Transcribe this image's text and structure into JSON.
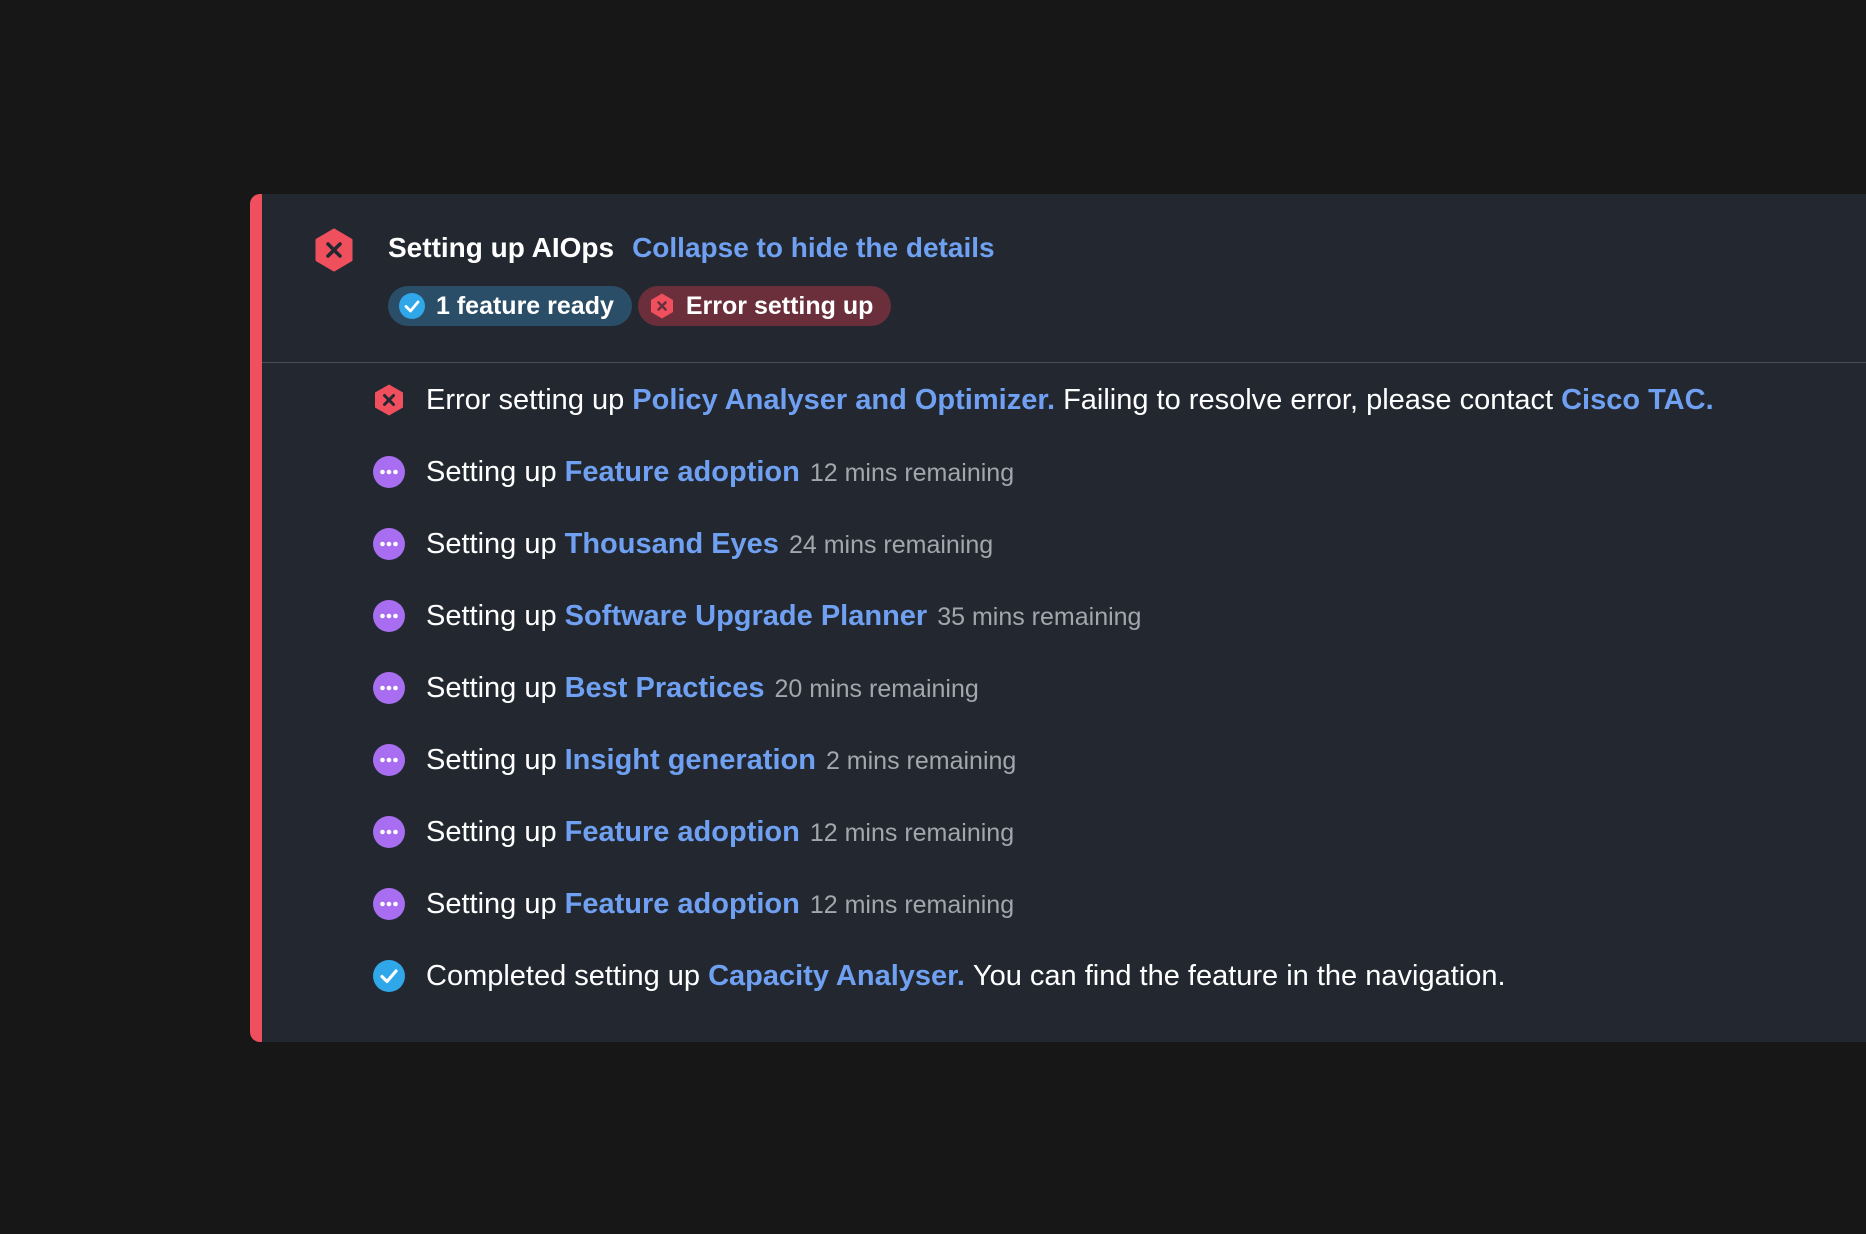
{
  "header": {
    "title": "Setting up AIOps",
    "collapse_link": "Collapse to hide the details",
    "badges": {
      "ready": "1 feature ready",
      "error": "Error setting up"
    }
  },
  "colors": {
    "accent_error": "#f0505e",
    "link": "#6fa0f2",
    "in_progress": "#a86df0",
    "success": "#2fa7e8"
  },
  "items": [
    {
      "status": "error",
      "prefix": "Error setting up",
      "feature": "Policy Analyser and Optimizer.",
      "suffix": "Failing to resolve error, please contact",
      "extra_link": "Cisco TAC."
    },
    {
      "status": "in-progress",
      "prefix": "Setting up",
      "feature": "Feature adoption",
      "remaining": "12 mins remaining"
    },
    {
      "status": "in-progress",
      "prefix": "Setting up",
      "feature": "Thousand Eyes",
      "remaining": "24 mins remaining"
    },
    {
      "status": "in-progress",
      "prefix": "Setting up",
      "feature": "Software Upgrade Planner",
      "remaining": "35 mins remaining"
    },
    {
      "status": "in-progress",
      "prefix": "Setting up",
      "feature": "Best Practices",
      "remaining": "20 mins remaining"
    },
    {
      "status": "in-progress",
      "prefix": "Setting up",
      "feature": "Insight generation",
      "remaining": "2 mins remaining"
    },
    {
      "status": "in-progress",
      "prefix": "Setting up",
      "feature": "Feature adoption",
      "remaining": "12 mins remaining"
    },
    {
      "status": "in-progress",
      "prefix": "Setting up",
      "feature": "Feature adoption",
      "remaining": "12 mins remaining"
    },
    {
      "status": "complete",
      "prefix": "Completed setting up",
      "feature": "Capacity Analyser.",
      "suffix": "You can find the feature in the navigation."
    }
  ]
}
